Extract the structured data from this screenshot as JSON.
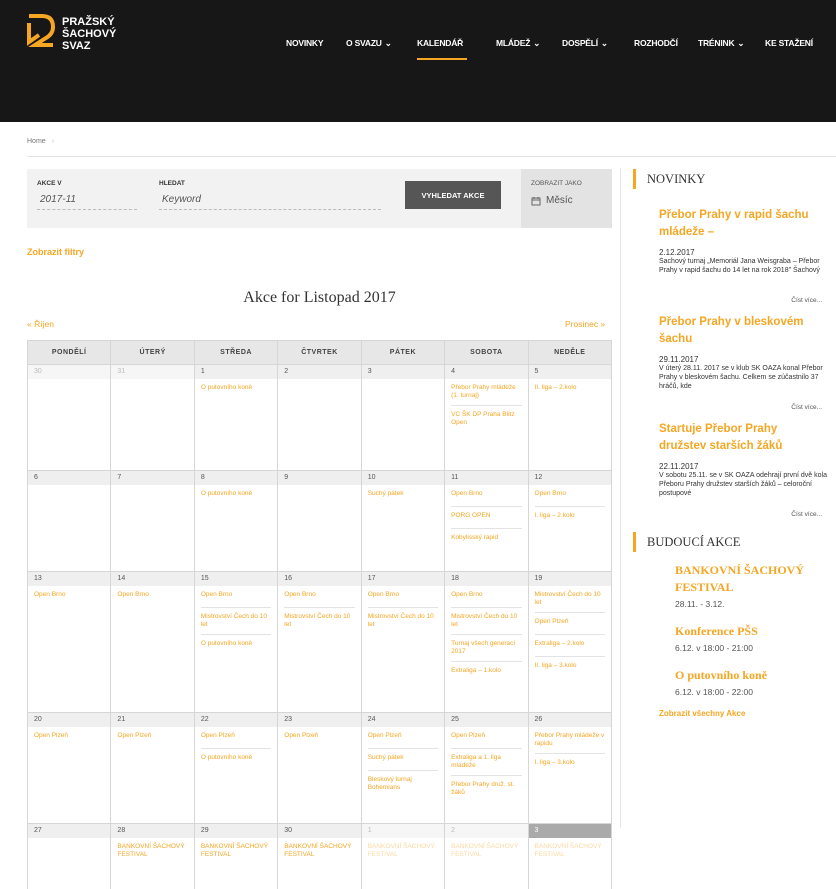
{
  "logo": {
    "lines": [
      "PRAŽSKÝ",
      "ŠACHOVÝ",
      "SVAZ"
    ]
  },
  "nav": {
    "items": [
      {
        "label": "NOVINKY",
        "caret": ""
      },
      {
        "label": "O SVAZU",
        "caret": "⌄"
      },
      {
        "label": "KALENDÁŘ",
        "caret": ""
      },
      {
        "label": "MLÁDEŽ",
        "caret": "⌄"
      },
      {
        "label": "DOSPĚLÍ",
        "caret": "⌄"
      },
      {
        "label": "ROZHODČÍ",
        "caret": ""
      },
      {
        "label": "TRÉNINK",
        "caret": "⌄"
      },
      {
        "label": "KE STAŽENÍ",
        "caret": ""
      }
    ],
    "active_index": 2
  },
  "breadcrumb": {
    "home": "Home",
    "sep": "›"
  },
  "filter": {
    "akce_label": "AKCE V",
    "akce_value": "2017-11",
    "hledat_label": "HLEDAT",
    "hledat_placeholder": "Keyword",
    "search_button": "VYHLEDAT AKCE",
    "zobrazit_label": "ZOBRAZIT JAKO",
    "zobrazit_value": "Měsíc"
  },
  "show_filters": "Zobrazit filtry",
  "calendar": {
    "title": "Akce for Listopad 2017",
    "prev": "« Říjen",
    "next": "Prosinec »",
    "weekdays": [
      "PONDĚLÍ",
      "ÚTERÝ",
      "STŘEDA",
      "ČTVRTEK",
      "PÁTEK",
      "SOBOTA",
      "NEDĚLE"
    ],
    "weeks": [
      [
        {
          "d": "30",
          "o": true,
          "e": []
        },
        {
          "d": "31",
          "o": true,
          "e": []
        },
        {
          "d": "1",
          "e": [
            "O putovního koně"
          ]
        },
        {
          "d": "2",
          "e": []
        },
        {
          "d": "3",
          "e": []
        },
        {
          "d": "4",
          "e": [
            "Přebor Prahy mládeže (1. turnaj)",
            "VC ŠK DP Praha Blitz Open"
          ]
        },
        {
          "d": "5",
          "e": [
            "II. liga – 2.kolo"
          ]
        }
      ],
      [
        {
          "d": "6",
          "e": []
        },
        {
          "d": "7",
          "e": []
        },
        {
          "d": "8",
          "e": [
            "O putovního koně"
          ]
        },
        {
          "d": "9",
          "e": []
        },
        {
          "d": "10",
          "e": [
            "Suchý pátek"
          ]
        },
        {
          "d": "11",
          "e": [
            "Open Brno",
            "PORG OPEN",
            "Kobylisský rapid"
          ]
        },
        {
          "d": "12",
          "e": [
            "Open Brno",
            "I. liga – 2.kolo"
          ]
        }
      ],
      [
        {
          "d": "13",
          "e": [
            "Open Brno"
          ]
        },
        {
          "d": "14",
          "e": [
            "Open Brno"
          ]
        },
        {
          "d": "15",
          "e": [
            "Open Brno",
            "Mistrovství Čech do 10 let",
            "O putovního koně"
          ]
        },
        {
          "d": "16",
          "e": [
            "Open Brno",
            "Mistrovství Čech do 10 let"
          ]
        },
        {
          "d": "17",
          "e": [
            "Open Brno",
            "Mistrovství Čech do 10 let"
          ]
        },
        {
          "d": "18",
          "e": [
            "Open Brno",
            "Mistrovství Čech do 10 let",
            "Turnaj všech generací 2017",
            "Extraliga – 1.kolo"
          ]
        },
        {
          "d": "19",
          "e": [
            "Mistrovství Čech do 10 let",
            "Open Plzeň",
            "Extraliga – 2.kolo",
            "II. liga – 3.kolo"
          ]
        }
      ],
      [
        {
          "d": "20",
          "e": [
            "Open Plzeň"
          ]
        },
        {
          "d": "21",
          "e": [
            "Open Plzeň"
          ]
        },
        {
          "d": "22",
          "e": [
            "Open Plzeň",
            "O putovního koně"
          ]
        },
        {
          "d": "23",
          "e": [
            "Open Plzeň"
          ]
        },
        {
          "d": "24",
          "e": [
            "Open Plzeň",
            "Suchý pátek",
            "Bleskový turnaj Bohemians"
          ]
        },
        {
          "d": "25",
          "e": [
            "Open Plzeň",
            "Extraliga a 1. liga mládeže",
            "Přebor Prahy druž. st. žáků"
          ]
        },
        {
          "d": "26",
          "e": [
            "Přebor Prahy mládeže v rapidu",
            "I. liga – 3.kolo"
          ]
        }
      ],
      [
        {
          "d": "27",
          "e": []
        },
        {
          "d": "28",
          "e": [
            "BANKOVNÍ ŠACHOVÝ FESTIVAL"
          ]
        },
        {
          "d": "29",
          "e": [
            "BANKOVNÍ ŠACHOVÝ FESTIVAL"
          ]
        },
        {
          "d": "30",
          "e": [
            "BANKOVNÍ ŠACHOVÝ FESTIVAL"
          ]
        },
        {
          "d": "1",
          "o": true,
          "e": [
            "BANKOVNÍ ŠACHOVÝ FESTIVAL"
          ]
        },
        {
          "d": "2",
          "o": true,
          "e": [
            "BANKOVNÍ ŠACHOVÝ FESTIVAL"
          ]
        },
        {
          "d": "3",
          "o": true,
          "t": true,
          "e": [
            "BANKOVNÍ ŠACHOVÝ FESTIVAL"
          ]
        }
      ]
    ]
  },
  "sidebar": {
    "news_heading": "NOVINKY",
    "news": [
      {
        "title": "Přebor Prahy v rapid šachu mládeže –",
        "date": "2.12.2017",
        "text": "Šachový turnaj „Memoriál Jana Weisgraba – Přebor Prahy v rapid šachu do 14 let na rok 2018\" Šachový",
        "more": "Číst více..."
      },
      {
        "title": "Přebor Prahy v bleskovém šachu",
        "date": "29.11.2017",
        "text": "V úterý 28.11. 2017 se v klub SK OAZA konal Přebor Prahy v bleskovém šachu. Celkem se zúčastnilo 37 hráčů, kde",
        "more": "Číst více..."
      },
      {
        "title": "Startuje Přebor Prahy družstev starších žáků",
        "date": "22.11.2017",
        "text": "V sobotu 25.11. se v SK OAZA odehrají první dvě kola Přeboru Prahy družstev starších žáků – celoroční postupové",
        "more": "Číst více..."
      }
    ],
    "upcoming_heading": "BUDOUCÍ AKCE",
    "upcoming": [
      {
        "title": "BANKOVNÍ ŠACHOVÝ FESTIVAL",
        "date": "28.11. - 3.12."
      },
      {
        "title": "Konference PŠS",
        "date": "6.12. v 18:00 - 21:00"
      },
      {
        "title": "O putovního koně",
        "date": "6.12. v 18:00 - 22:00"
      }
    ],
    "all_events": "Zobrazit všechny Akce"
  },
  "colors": {
    "accent": "#f5a623",
    "header_bg": "#171717"
  }
}
